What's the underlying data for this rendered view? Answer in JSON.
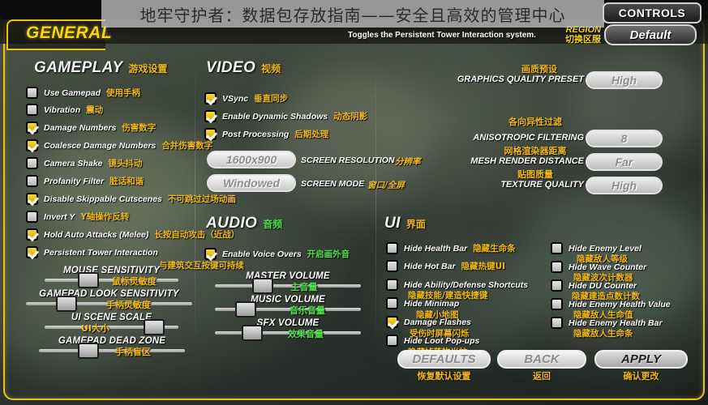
{
  "window": {
    "title_overlay": "地牢守护者：数据包存放指南——安全且高效的管理中心",
    "tooltip": "Toggles the Persistent Tower Interaction system.",
    "tab_general": "GENERAL",
    "tab_controls": "CONTROLS",
    "region_label_en": "REGION",
    "region_label_cn": "切换区服",
    "region_value": "Default"
  },
  "gameplay": {
    "header_en": "GAMEPLAY",
    "header_cn": "游戏设置",
    "options": [
      {
        "en": "Use Gamepad",
        "cn": "使用手柄",
        "checked": false
      },
      {
        "en": "Vibration",
        "cn": "震动",
        "checked": false
      },
      {
        "en": "Damage Numbers",
        "cn": "伤害数字",
        "checked": true
      },
      {
        "en": "Coalesce Damage Numbers",
        "cn": "合并伤害数字",
        "checked": true
      },
      {
        "en": "Camera Shake",
        "cn": "镜头抖动",
        "checked": false
      },
      {
        "en": "Profanity Filter",
        "cn": "脏话和谐",
        "checked": false
      },
      {
        "en": "Disable Skippable Cutscenes",
        "cn": "不可跳过过场动画",
        "checked": true
      },
      {
        "en": "Invert Y",
        "cn": "Y轴操作反转",
        "checked": false
      },
      {
        "en": "Hold Auto Attacks (Melee)",
        "cn": "长按自动攻击（近战）",
        "checked": true
      },
      {
        "en": "Persistent Tower Interaction",
        "cn": "与建筑交互按键可持续",
        "checked": true
      }
    ],
    "sliders": [
      {
        "en": "MOUSE SENSITIVITY",
        "cn": "鼠标灵敏度",
        "value": 25
      },
      {
        "en": "GAMEPAD LOOK SENSITIVITY",
        "cn": "手柄灵敏度",
        "value": 18
      },
      {
        "en": "UI SCENE SCALE",
        "cn": "UI大小",
        "value": 80
      },
      {
        "en": "GAMEPAD DEAD ZONE",
        "cn": "手柄盲区",
        "value": 27
      }
    ]
  },
  "video": {
    "header_en": "VIDEO",
    "header_cn": "视频",
    "options": [
      {
        "en": "VSync",
        "cn": "垂直同步",
        "checked": true
      },
      {
        "en": "Enable Dynamic Shadows",
        "cn": "动态阴影",
        "checked": true
      },
      {
        "en": "Post Processing",
        "cn": "后期处理",
        "checked": true
      }
    ],
    "dropdowns": [
      {
        "value": "1600x900",
        "label_en": "SCREEN RESOLUTION",
        "label_cn": "分辨率"
      },
      {
        "value": "Windowed",
        "label_en": "SCREEN MODE",
        "label_cn": "窗口/全屏"
      }
    ]
  },
  "audio": {
    "header_en": "AUDIO",
    "header_cn": "音频",
    "options": [
      {
        "en": "Enable Voice Overs",
        "cn": "开启画外音",
        "checked": true
      }
    ],
    "sliders": [
      {
        "en": "MASTER VOLUME",
        "cn": "主音量",
        "value": 34
      },
      {
        "en": "MUSIC VOLUME",
        "cn": "音乐音量",
        "value": 22
      },
      {
        "en": "SFX VOLUME",
        "cn": "效果音量",
        "value": 27
      }
    ]
  },
  "graphics": {
    "rows": [
      {
        "label_en": "GRAPHICS QUALITY PRESET",
        "label_cn": "画质预设",
        "value": "High"
      },
      {
        "label_en": "ANISOTROPIC FILTERING",
        "label_cn": "各向异性过滤",
        "value": "8"
      },
      {
        "label_en": "MESH RENDER DISTANCE",
        "label_cn": "网格渲染器距离",
        "value": "Far"
      },
      {
        "label_en": "TEXTURE QUALITY",
        "label_cn": "贴图质量",
        "value": "High"
      }
    ]
  },
  "ui_section": {
    "header_en": "UI",
    "header_cn": "界面",
    "left_column": [
      {
        "en": "Hide Health Bar",
        "cn": "隐藏生命条",
        "checked": false,
        "inline": true
      },
      {
        "en": "Hide Hot Bar",
        "cn": "隐藏热键UI",
        "checked": false,
        "inline": true
      },
      {
        "en": "Hide Ability/Defense Shortcuts",
        "cn": "隐藏技能/建造快捷键",
        "checked": false,
        "inline": false
      },
      {
        "en": "Hide Minimap",
        "cn": "隐藏小地图",
        "checked": false,
        "inline": false
      },
      {
        "en": "Damage Flashes",
        "cn": "受伤时屏幕闪烁",
        "checked": true,
        "inline": false
      },
      {
        "en": "Hide Loot Pop-ups",
        "cn": "隐藏掉落物光柱",
        "checked": false,
        "inline": false
      }
    ],
    "right_column": [
      {
        "en": "Hide Enemy Level",
        "cn": "隐藏敌人等级",
        "checked": false
      },
      {
        "en": "Hide Wave Counter",
        "cn": "隐藏波次计数器",
        "checked": false
      },
      {
        "en": "Hide DU Counter",
        "cn": "隐藏建造点数计数",
        "checked": false
      },
      {
        "en": "Hide Enemy Health Value",
        "cn": "隐藏敌人生命值",
        "checked": false
      },
      {
        "en": "Hide Enemy Health Bar",
        "cn": "隐藏敌人生命条",
        "checked": false
      }
    ]
  },
  "footer": {
    "buttons": [
      {
        "en": "DEFAULTS",
        "cn": "恢复默认设置",
        "style": "grey"
      },
      {
        "en": "BACK",
        "cn": "返回",
        "style": "grey"
      },
      {
        "en": "APPLY",
        "cn": "确认更改",
        "style": "active"
      }
    ]
  },
  "colors": {
    "accent_yellow": "#f4d518",
    "cn_yellow": "#f0b81c",
    "cn_green": "#4fe04f"
  }
}
